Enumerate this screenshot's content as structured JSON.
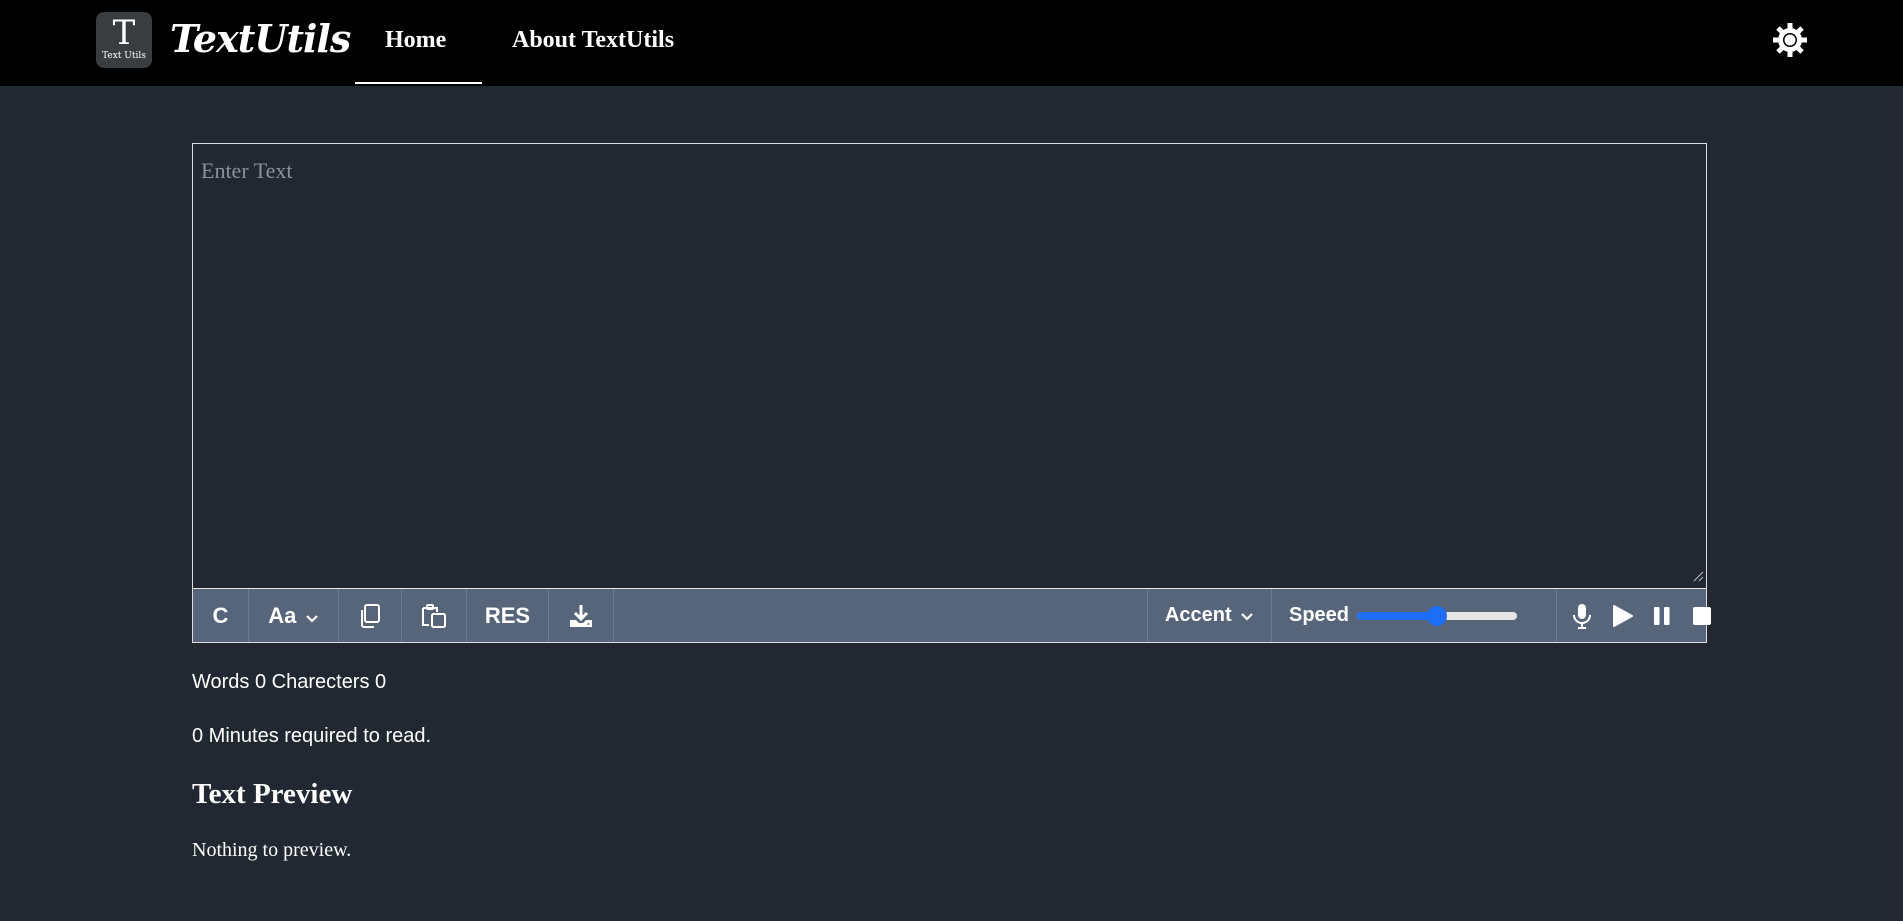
{
  "navbar": {
    "logo_letter": "T",
    "logo_subtitle": "Text Utils",
    "brand": "TextUtils",
    "links": [
      "Home",
      "About TextUtils"
    ],
    "active_link": "Home",
    "theme_toggle_icon": "sun-icon"
  },
  "editor": {
    "placeholder": "Enter Text",
    "value": ""
  },
  "toolbar": {
    "clear_label": "C",
    "case_label": "Aa",
    "case_icon": "chevron-down-icon",
    "copy_icon": "copy-icon",
    "paste_icon": "paste-icon",
    "res_label": "RES",
    "download_icon": "download-icon",
    "accent_label": "Accent",
    "accent_icon": "chevron-down-icon",
    "speed_label": "Speed",
    "speed_level": 0.5,
    "mic_icon": "mic-icon",
    "play_icon": "play-icon",
    "pause_icon": "pause-icon",
    "stop_icon": "stop-icon"
  },
  "stats": {
    "text": "Words 0 Charecters 0",
    "read_time": "0 Minutes required to read."
  },
  "preview": {
    "title": "Text Preview",
    "text": "Nothing to preview."
  },
  "colors": {
    "navbar_bg": "#000000",
    "page_bg": "#222831",
    "toolbar_bg": "#56657a",
    "slider_accent": "#1e6ef5"
  }
}
